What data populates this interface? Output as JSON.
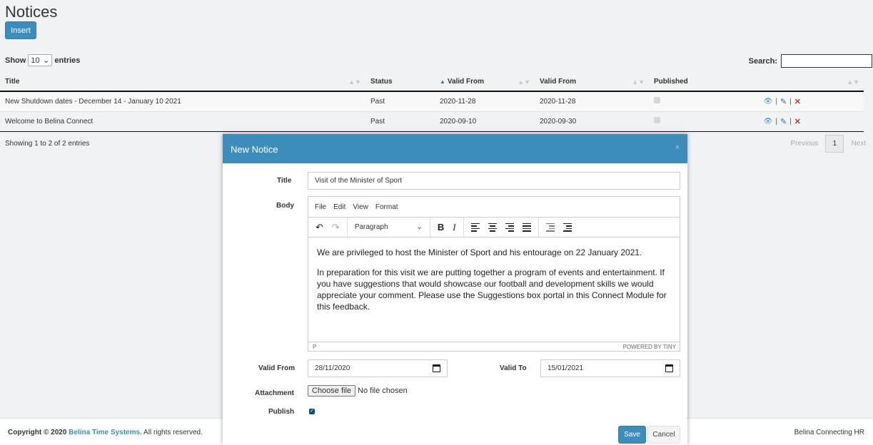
{
  "page": {
    "title": "Notices",
    "insert_label": "Insert"
  },
  "table_controls": {
    "show_label": "Show",
    "entries_value": "10",
    "entries_label": "entries",
    "search_label": "Search:",
    "search_value": ""
  },
  "columns": [
    "Title",
    "Status",
    "Valid From",
    "Valid From",
    "Published",
    ""
  ],
  "rows": [
    {
      "title": "New Shutdown dates - December 14 - January 10 2021",
      "status": "Past",
      "valid_from": "2020-11-28",
      "valid_to": "2020-11-28",
      "published": true
    },
    {
      "title": "Welcome to Belina Connect",
      "status": "Past",
      "valid_from": "2020-09-10",
      "valid_to": "2020-09-30",
      "published": true
    }
  ],
  "row_actions": {
    "separator": "|"
  },
  "pagination": {
    "info": "Showing 1 to 2 of 2 entries",
    "previous": "Previous",
    "current": "1",
    "next": "Next"
  },
  "footer": {
    "copyright_prefix": "Copyright © 2020 ",
    "company": "Belina Time Systems.",
    "rights": " All rights reserved.",
    "right_text": "Belina Connecting HR"
  },
  "modal": {
    "title": "New Notice",
    "close": "×",
    "title_label": "Title",
    "title_value": "Visit of the Minister of Sport",
    "body_label": "Body",
    "menu": [
      "File",
      "Edit",
      "View",
      "Format"
    ],
    "block_format": "Paragraph",
    "body_paragraphs": [
      "We are privileged to host the Minister of Sport and his entourage on 22 January 2021.",
      "In preparation for this visit we are putting together a program of events and entertainment.  If you have suggestions that would showcase our football and development skills we would appreciate your comment.  Please use the Suggestions box portal in this Connect Module for this feedback."
    ],
    "status_path": "P",
    "powered_by": "POWERED BY TINY",
    "valid_from_label": "Valid From",
    "valid_from_value": "28/11/2020",
    "valid_to_label": "Valid To",
    "valid_to_value": "15/01/2021",
    "attachment_label": "Attachment",
    "choose_file": "Choose file",
    "no_file": "No file chosen",
    "publish_label": "Publish",
    "publish_checked": true,
    "save_label": "Save",
    "cancel_label": "Cancel"
  },
  "colors": {
    "primary": "#3c8dbc",
    "delete": "#c0392b"
  },
  "icons": [
    "eye-icon",
    "pencil-icon",
    "delete-x-icon",
    "undo-icon",
    "redo-icon",
    "bold-icon",
    "italic-icon",
    "align-left-icon",
    "align-center-icon",
    "align-right-icon",
    "justify-icon",
    "outdent-icon",
    "indent-icon",
    "calendar-icon"
  ]
}
